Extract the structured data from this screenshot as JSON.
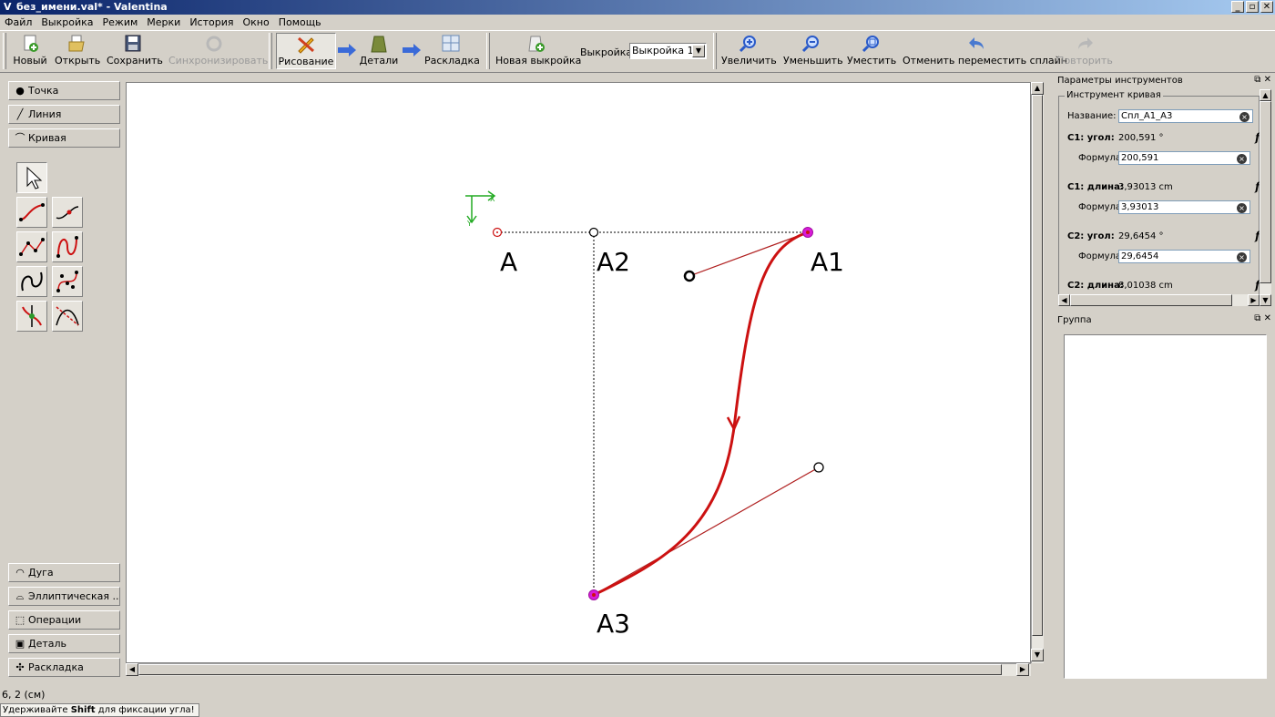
{
  "window": {
    "title": "без_имени.val* - Valentina",
    "controls": [
      "_",
      "▫",
      "✕"
    ]
  },
  "menu": [
    "Файл",
    "Выкройка",
    "Режим",
    "Мерки",
    "История",
    "Окно",
    "Помощь"
  ],
  "toolbar": {
    "new": "Новый",
    "open": "Открыть",
    "save": "Сохранить",
    "sync": "Синхронизировать",
    "draw": "Рисование",
    "details": "Детали",
    "layout": "Раскладка",
    "new_pattern": "Новая выкройка",
    "pattern_label": "Выкройка:",
    "pattern_value": "Выкройка 1",
    "zoom_in": "Увеличить",
    "zoom_out": "Уменьшить",
    "fit": "Уместить",
    "undo": "Отменить переместить сплайн",
    "redo": "Повторить"
  },
  "left_panel": {
    "point": "Точка",
    "line": "Линия",
    "curve": "Кривая",
    "arc": "Дуга",
    "elliptical": "Эллиптическая ...",
    "operations": "Операции",
    "detail": "Деталь",
    "layout": "Раскладка"
  },
  "canvas": {
    "points": [
      "A",
      "A2",
      "A1",
      "A3"
    ],
    "axis_x": "X",
    "axis_y": "Y",
    "colors": {
      "curve": "#cc1111",
      "selected_point": "#d81bd8",
      "control_line": "#b02020"
    }
  },
  "tool_options": {
    "title": "Параметры инструментов",
    "group_title": "Инструмент кривая",
    "name_label": "Название:",
    "name_value": "Спл_A1_A3",
    "c1_angle_label": "C1: угол:",
    "c1_angle_value": "200,591 °",
    "formula_label": "Формула",
    "c1_angle_formula": "200,591",
    "c1_length_label": "C1: длина:",
    "c1_length_value": "3,93013 cm",
    "c1_length_formula": "3,93013",
    "c2_angle_label": "C2: угол:",
    "c2_angle_value": "29,6454 °",
    "c2_angle_formula": "29,6454",
    "c2_length_label": "C2: длина:",
    "c2_length_value": "8,01038 cm",
    "fx": "f"
  },
  "group_panel": {
    "title": "Группа"
  },
  "status": {
    "coords": "6, 2 (см)",
    "hint_prefix": "Удерживайте ",
    "hint_key": "Shift",
    "hint_suffix": " для фиксации угла!"
  }
}
